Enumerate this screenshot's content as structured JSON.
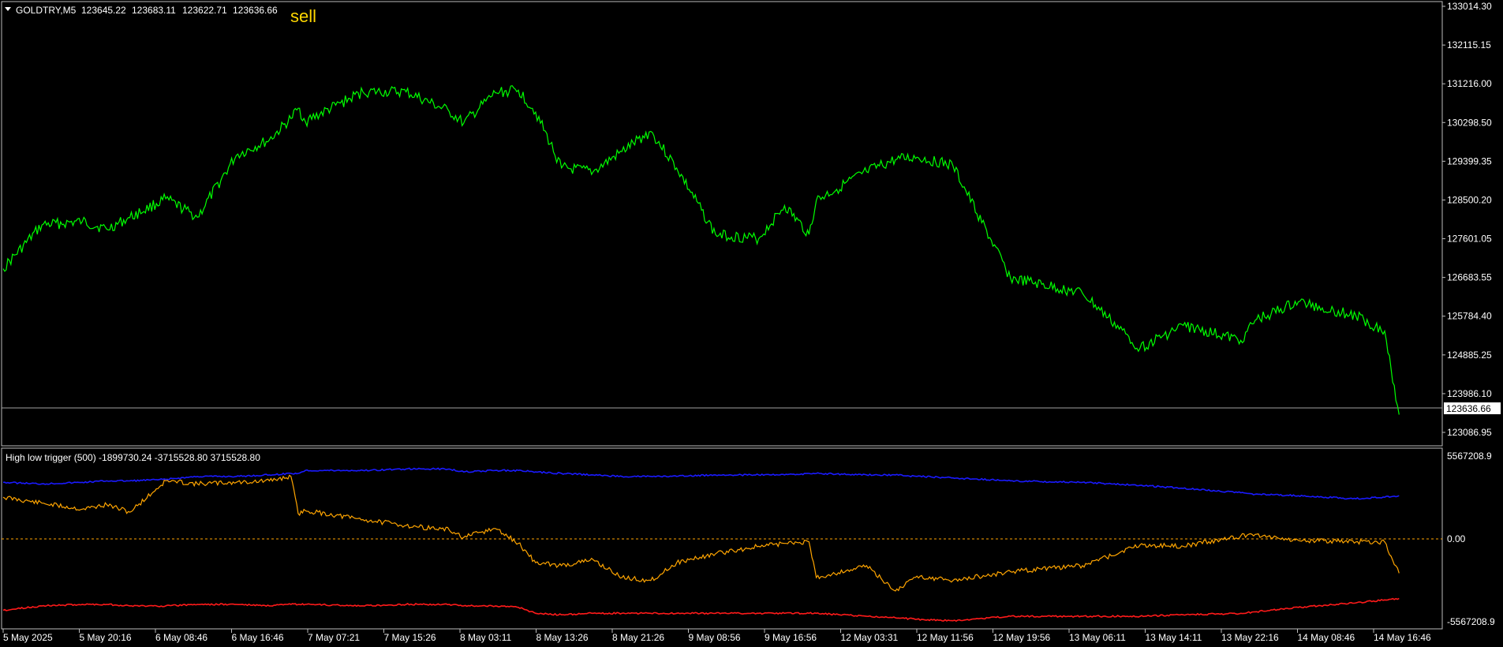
{
  "main_panel": {
    "symbol": "GOLDTRY,M5",
    "open": "123645.22",
    "high": "123683.11",
    "low": "123622.71",
    "close": "123636.66",
    "signal_label": "sell",
    "y_ticks": [
      "133014.30",
      "132115.15",
      "131216.00",
      "130298.50",
      "129399.35",
      "128500.20",
      "127601.05",
      "126683.55",
      "125784.40",
      "124885.25",
      "123986.10",
      "123086.95"
    ],
    "current_price_label": "123636.66",
    "colors": {
      "price_line": "#00ff00",
      "current_line": "#a0a0a0",
      "signal": "#ffd700"
    }
  },
  "indicator_panel": {
    "title": "High low trigger (500) -1899730.24 -3715528.80 3715528.80",
    "y_ticks": [
      "5567208.9",
      "0.00",
      "-5567208.9"
    ],
    "colors": {
      "upper": "#1a1aff",
      "middle": "#ffa500",
      "lower": "#ff1a1a",
      "zero_line": "#ffa500"
    }
  },
  "time_axis": [
    "5 May 2025",
    "5 May 20:16",
    "6 May 08:46",
    "6 May 16:46",
    "7 May 07:21",
    "7 May 15:26",
    "8 May 03:11",
    "8 May 13:26",
    "8 May 21:26",
    "9 May 08:56",
    "9 May 16:56",
    "12 May 03:31",
    "12 May 11:56",
    "12 May 19:56",
    "13 May 06:11",
    "13 May 14:11",
    "13 May 22:16",
    "14 May 08:46",
    "14 May 16:46"
  ],
  "chart_data": [
    {
      "type": "line",
      "title": "GOLDTRY,M5",
      "x": [
        0,
        0.027,
        0.055,
        0.072,
        0.088,
        0.113,
        0.135,
        0.162,
        0.185,
        0.2,
        0.205,
        0.21,
        0.25,
        0.28,
        0.31,
        0.32,
        0.342,
        0.358,
        0.37,
        0.388,
        0.41,
        0.43,
        0.45,
        0.468,
        0.495,
        0.525,
        0.543,
        0.56,
        0.565,
        0.6,
        0.62,
        0.635,
        0.66,
        0.7,
        0.75,
        0.79,
        0.82,
        0.86,
        0.87,
        0.9,
        0.94,
        0.96,
        0.97
      ],
      "series": [
        {
          "name": "GOLDTRY,M5",
          "values": [
            126900,
            127920,
            128000,
            127820,
            128090,
            128530,
            128100,
            129540,
            129900,
            130400,
            130640,
            130330,
            131020,
            131020,
            130560,
            130290,
            131000,
            131060,
            130550,
            129250,
            129160,
            129630,
            130100,
            129250,
            127700,
            127600,
            128370,
            127700,
            128490,
            129160,
            129440,
            129500,
            129300,
            126680,
            126330,
            125050,
            125580,
            125230,
            125700,
            126130,
            125800,
            125450,
            123500
          ]
        }
      ],
      "ylim": [
        123086.95,
        133014.3
      ],
      "grid": false
    },
    {
      "type": "line",
      "title": "High low trigger (500) -1899730.24 -3715528.80 3715528.80",
      "x": [
        0,
        0.027,
        0.055,
        0.072,
        0.088,
        0.113,
        0.135,
        0.162,
        0.185,
        0.2,
        0.205,
        0.21,
        0.25,
        0.28,
        0.31,
        0.32,
        0.342,
        0.358,
        0.37,
        0.388,
        0.41,
        0.43,
        0.45,
        0.468,
        0.495,
        0.525,
        0.543,
        0.56,
        0.565,
        0.6,
        0.62,
        0.635,
        0.66,
        0.7,
        0.75,
        0.79,
        0.82,
        0.86,
        0.87,
        0.9,
        0.94,
        0.96,
        0.97
      ],
      "series": [
        {
          "values": [
            3800000,
            3700000,
            3800000,
            3900000,
            3900000,
            4000000,
            4200000,
            4200000,
            4300000,
            4400000,
            4400000,
            4600000,
            4600000,
            4700000,
            4700000,
            4500000,
            4600000,
            4600000,
            4500000,
            4400000,
            4300000,
            4200000,
            4200000,
            4200000,
            4300000,
            4300000,
            4300000,
            4400000,
            4400000,
            4300000,
            4300000,
            4200000,
            4100000,
            3900000,
            3800000,
            3600000,
            3400000,
            3100000,
            3000000,
            2900000,
            2700000,
            2800000,
            2900000
          ]
        },
        {
          "values": [
            2800000,
            2400000,
            2000000,
            2300000,
            1800000,
            3900000,
            3700000,
            3800000,
            3900000,
            4200000,
            1700000,
            1900000,
            1300000,
            900000,
            600000,
            100000,
            700000,
            -300000,
            -1600000,
            -1800000,
            -1400000,
            -2600000,
            -2800000,
            -1600000,
            -1000000,
            -500000,
            -300000,
            -200000,
            -2600000,
            -1800000,
            -3500000,
            -2500000,
            -2800000,
            -2200000,
            -1800000,
            -400000,
            -500000,
            200000,
            300000,
            -100000,
            -200000,
            -200000,
            -2300000
          ]
        },
        {
          "values": [
            -4800000,
            -4500000,
            -4400000,
            -4400000,
            -4500000,
            -4500000,
            -4400000,
            -4400000,
            -4500000,
            -4400000,
            -4400000,
            -4400000,
            -4500000,
            -4400000,
            -4400000,
            -4500000,
            -4500000,
            -4600000,
            -5000000,
            -5100000,
            -5000000,
            -5000000,
            -5000000,
            -5000000,
            -5000000,
            -5000000,
            -5000000,
            -5000000,
            -5000000,
            -5200000,
            -5300000,
            -5400000,
            -5500000,
            -5200000,
            -5200000,
            -5200000,
            -5100000,
            -5000000,
            -4900000,
            -4600000,
            -4300000,
            -4100000,
            -4000000
          ]
        }
      ],
      "ylim": [
        -5567208.9,
        5567208.9
      ],
      "grid": false
    }
  ]
}
